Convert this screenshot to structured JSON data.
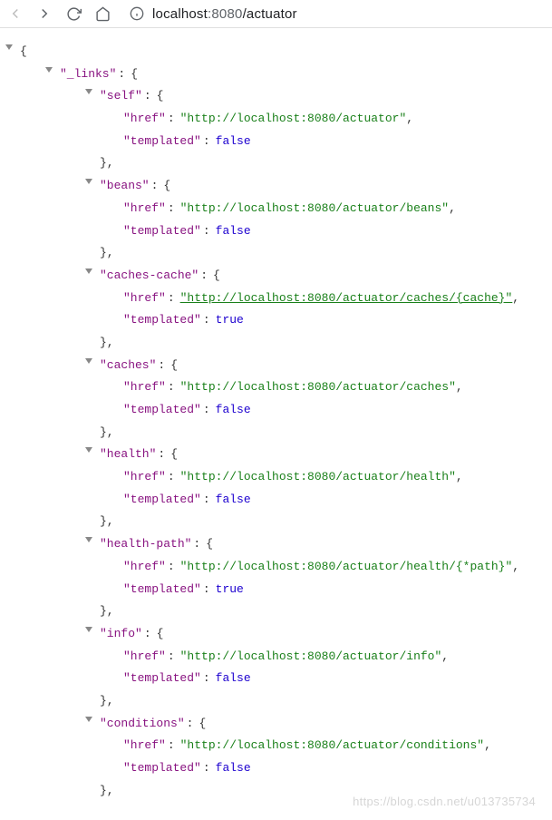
{
  "toolbar": {
    "url_scheme_host": "localhost",
    "url_port": ":8080",
    "url_path": "/actuator"
  },
  "json": {
    "root_open": "{",
    "links_key": "\"_links\"",
    "links_open": "{",
    "entries": [
      {
        "key": "\"self\"",
        "href_key": "\"href\"",
        "href_val": "\"http://localhost:8080/actuator\"",
        "tmpl_key": "\"templated\"",
        "tmpl_val": "false",
        "link": false
      },
      {
        "key": "\"beans\"",
        "href_key": "\"href\"",
        "href_val": "\"http://localhost:8080/actuator/beans\"",
        "tmpl_key": "\"templated\"",
        "tmpl_val": "false",
        "link": false
      },
      {
        "key": "\"caches-cache\"",
        "href_key": "\"href\"",
        "href_val": "\"http://localhost:8080/actuator/caches/{cache}\"",
        "tmpl_key": "\"templated\"",
        "tmpl_val": "true",
        "link": true
      },
      {
        "key": "\"caches\"",
        "href_key": "\"href\"",
        "href_val": "\"http://localhost:8080/actuator/caches\"",
        "tmpl_key": "\"templated\"",
        "tmpl_val": "false",
        "link": false
      },
      {
        "key": "\"health\"",
        "href_key": "\"href\"",
        "href_val": "\"http://localhost:8080/actuator/health\"",
        "tmpl_key": "\"templated\"",
        "tmpl_val": "false",
        "link": false
      },
      {
        "key": "\"health-path\"",
        "href_key": "\"href\"",
        "href_val": "\"http://localhost:8080/actuator/health/{*path}\"",
        "tmpl_key": "\"templated\"",
        "tmpl_val": "true",
        "link": false
      },
      {
        "key": "\"info\"",
        "href_key": "\"href\"",
        "href_val": "\"http://localhost:8080/actuator/info\"",
        "tmpl_key": "\"templated\"",
        "tmpl_val": "false",
        "link": false
      },
      {
        "key": "\"conditions\"",
        "href_key": "\"href\"",
        "href_val": "\"http://localhost:8080/actuator/conditions\"",
        "tmpl_key": "\"templated\"",
        "tmpl_val": "false",
        "link": false
      }
    ],
    "obj_open": "{",
    "obj_close_comma": "},",
    "comma": ","
  },
  "watermark": "https://blog.csdn.net/u013735734"
}
